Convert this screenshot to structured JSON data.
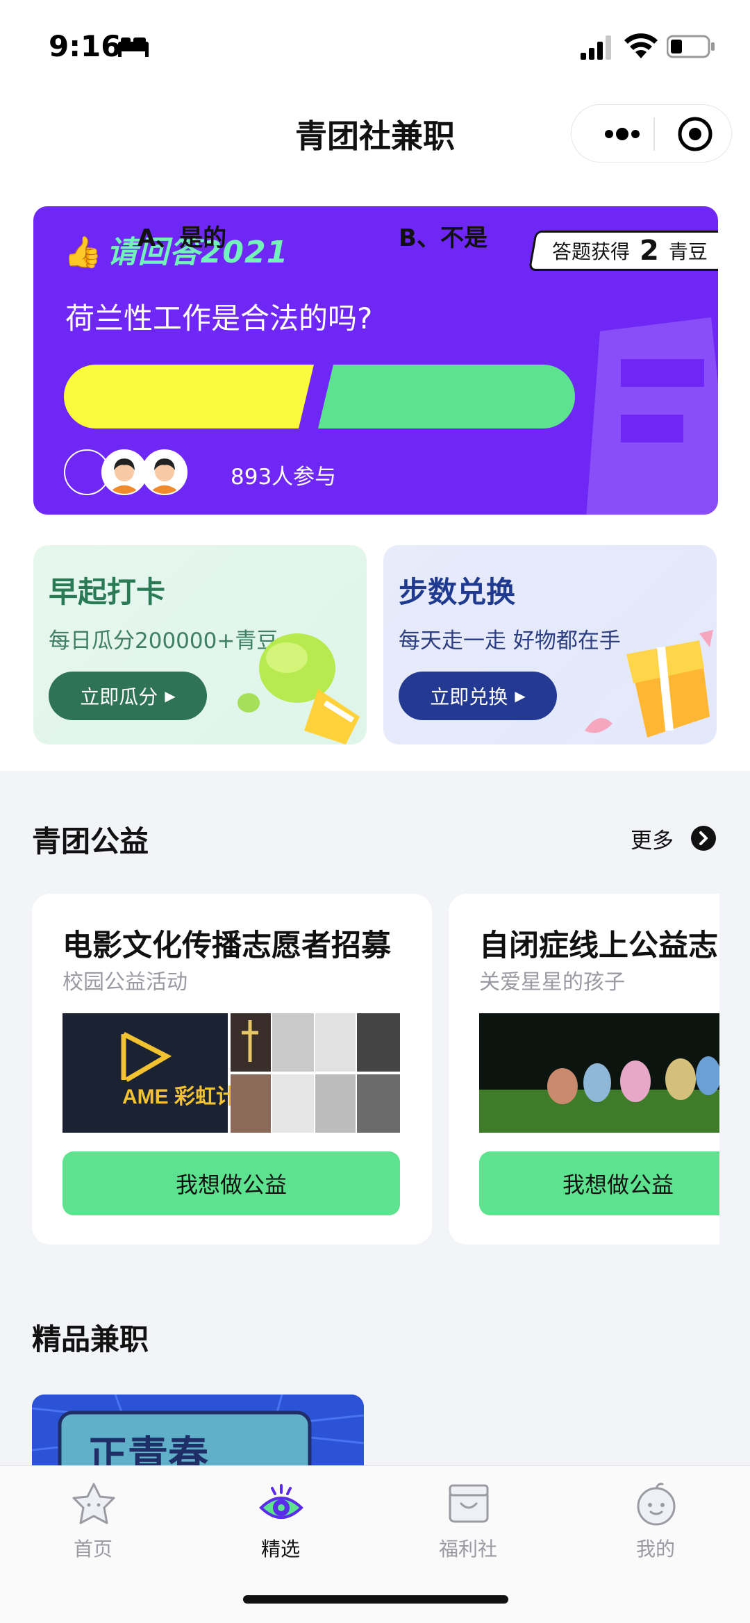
{
  "status_bar": {
    "time": "9:16"
  },
  "nav": {
    "title": "青团社兼职"
  },
  "quiz": {
    "logo": "请回答2021",
    "reward_prefix": "答题获得",
    "reward_amount": "2",
    "reward_unit": "青豆",
    "question": "荷兰性工作是合法的吗?",
    "option_a": "A、是的",
    "option_b": "B、不是",
    "participants": "893人参与"
  },
  "promos": [
    {
      "title": "早起打卡",
      "subtitle": "每日瓜分200000+青豆",
      "button": "立即瓜分"
    },
    {
      "title": "步数兑换",
      "subtitle": "每天走一走 好物都在手",
      "button": "立即兑换"
    }
  ],
  "charity_section": {
    "title": "青团公益",
    "more": "更多"
  },
  "charity_cards": [
    {
      "title": "电影文化传播志愿者招募",
      "subtitle": "校园公益活动",
      "button": "我想做公益",
      "image_text": "AME 彩虹计划"
    },
    {
      "title": "自闭症线上公益志",
      "subtitle": "关爱星星的孩子",
      "button": "我想做公益"
    }
  ],
  "jobs_section": {
    "title": "精品兼职",
    "card_text": "正青春"
  },
  "tabs": [
    {
      "label": "首页",
      "icon": "star-face-icon",
      "active": false
    },
    {
      "label": "精选",
      "icon": "eye-icon",
      "active": true
    },
    {
      "label": "福利社",
      "icon": "shop-icon",
      "active": false
    },
    {
      "label": "我的",
      "icon": "smile-face-icon",
      "active": false
    }
  ],
  "colors": {
    "quiz_bg": "#6f27f6",
    "option_a": "#fafa3c",
    "option_b": "#5de28f",
    "accent_green": "#5de28f",
    "active_tab": "#5b2bea"
  }
}
